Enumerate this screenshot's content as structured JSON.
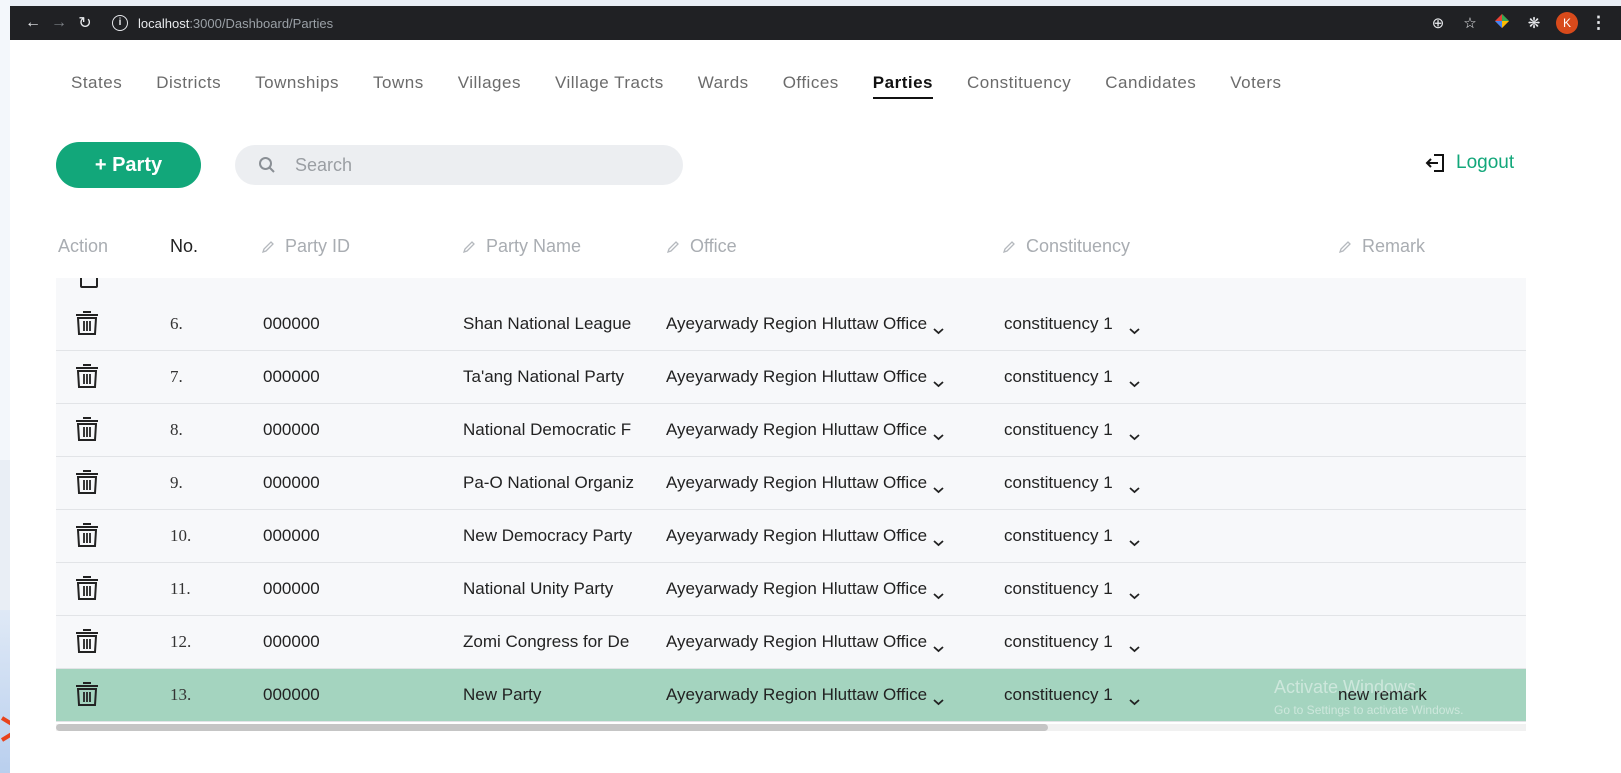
{
  "browser": {
    "url_host": "localhost",
    "url_path": ":3000/Dashboard/Parties",
    "profile_initial": "K"
  },
  "nav": {
    "tabs": [
      {
        "label": "States"
      },
      {
        "label": "Districts"
      },
      {
        "label": "Townships"
      },
      {
        "label": "Towns"
      },
      {
        "label": "Villages"
      },
      {
        "label": "Village Tracts"
      },
      {
        "label": "Wards"
      },
      {
        "label": "Offices"
      },
      {
        "label": "Parties",
        "active": true
      },
      {
        "label": "Constituency"
      },
      {
        "label": "Candidates"
      },
      {
        "label": "Voters"
      }
    ]
  },
  "toolbar": {
    "add_label": "+ Party",
    "search_placeholder": "Search",
    "logout_label": "Logout"
  },
  "table": {
    "headers": {
      "action": "Action",
      "no": "No.",
      "party_id": "Party ID",
      "party_name": "Party Name",
      "office": "Office",
      "constituency": "Constituency",
      "remark": "Remark"
    },
    "rows": [
      {
        "no": "6.",
        "party_id": "000000",
        "party_name": "Shan National League",
        "office": "Ayeyarwady Region Hluttaw Office",
        "constituency": "constituency 1",
        "remark": ""
      },
      {
        "no": "7.",
        "party_id": "000000",
        "party_name": "Ta'ang National Party",
        "office": "Ayeyarwady Region Hluttaw Office",
        "constituency": "constituency 1",
        "remark": ""
      },
      {
        "no": "8.",
        "party_id": "000000",
        "party_name": "National Democratic F",
        "office": "Ayeyarwady Region Hluttaw Office",
        "constituency": "constituency 1",
        "remark": ""
      },
      {
        "no": "9.",
        "party_id": "000000",
        "party_name": "Pa-O National Organiz",
        "office": "Ayeyarwady Region Hluttaw Office",
        "constituency": "constituency 1",
        "remark": ""
      },
      {
        "no": "10.",
        "party_id": "000000",
        "party_name": "New Democracy Party",
        "office": "Ayeyarwady Region Hluttaw Office",
        "constituency": "constituency 1",
        "remark": ""
      },
      {
        "no": "11.",
        "party_id": "000000",
        "party_name": "National Unity Party",
        "office": "Ayeyarwady Region Hluttaw Office",
        "constituency": "constituency 1",
        "remark": ""
      },
      {
        "no": "12.",
        "party_id": "000000",
        "party_name": "Zomi Congress for De",
        "office": "Ayeyarwady Region Hluttaw Office",
        "constituency": "constituency 1",
        "remark": ""
      },
      {
        "no": "13.",
        "party_id": "000000",
        "party_name": "New Party",
        "office": "Ayeyarwady Region Hluttaw Office",
        "constituency": "constituency 1",
        "remark": "new remark",
        "selected": true
      }
    ]
  },
  "watermark": {
    "line1": "Activate Windows",
    "line2": "Go to Settings to activate Windows."
  },
  "colors": {
    "accent": "#12a77a",
    "selected_row": "#a4d4bf",
    "arrow": "#e8431c"
  }
}
